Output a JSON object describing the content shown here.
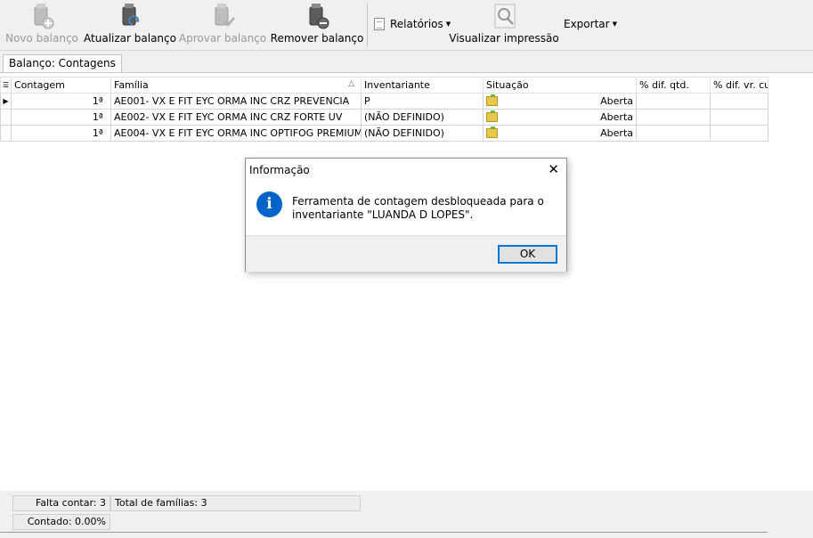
{
  "toolbar": {
    "novo": "Novo balanço",
    "atualizar": "Atualizar balanço",
    "aprovar": "Aprovar balanço",
    "remover": "Remover balanço",
    "relatorios": "Relatórios",
    "visualizar": "Visualizar impressão",
    "exportar": "Exportar"
  },
  "tab": {
    "label": "Balanço: Contagens"
  },
  "grid": {
    "headers": [
      "Contagem",
      "Família",
      "Inventariante",
      "Situação",
      "% dif. qtd.",
      "% dif. vr. cu"
    ],
    "rows": [
      {
        "contagem": "1ª",
        "familia": "AE001- VX E FIT EYC ORMA INC CRZ PREVENCIA",
        "inventariante": "P",
        "situacao": "Aberta"
      },
      {
        "contagem": "1ª",
        "familia": "AE002- VX E FIT EYC ORMA INC CRZ FORTE UV",
        "inventariante": "(NÃO DEFINIDO)",
        "situacao": "Aberta"
      },
      {
        "contagem": "1ª",
        "familia": "AE004- VX E FIT EYC ORMA INC OPTIFOG PREMIUM",
        "inventariante": "(NÃO DEFINIDO)",
        "situacao": "Aberta"
      }
    ]
  },
  "footer": {
    "falta": "Falta contar: 3",
    "total": "Total de famílias: 3",
    "contado": "Contado: 0.00%"
  },
  "dialog": {
    "title": "Informação",
    "message": "Ferramenta de contagem desbloqueada para o inventariante \"LUANDA D LOPES\".",
    "ok": "OK"
  },
  "colors": {
    "accent": "#0078d7",
    "info": "#0064c8"
  }
}
